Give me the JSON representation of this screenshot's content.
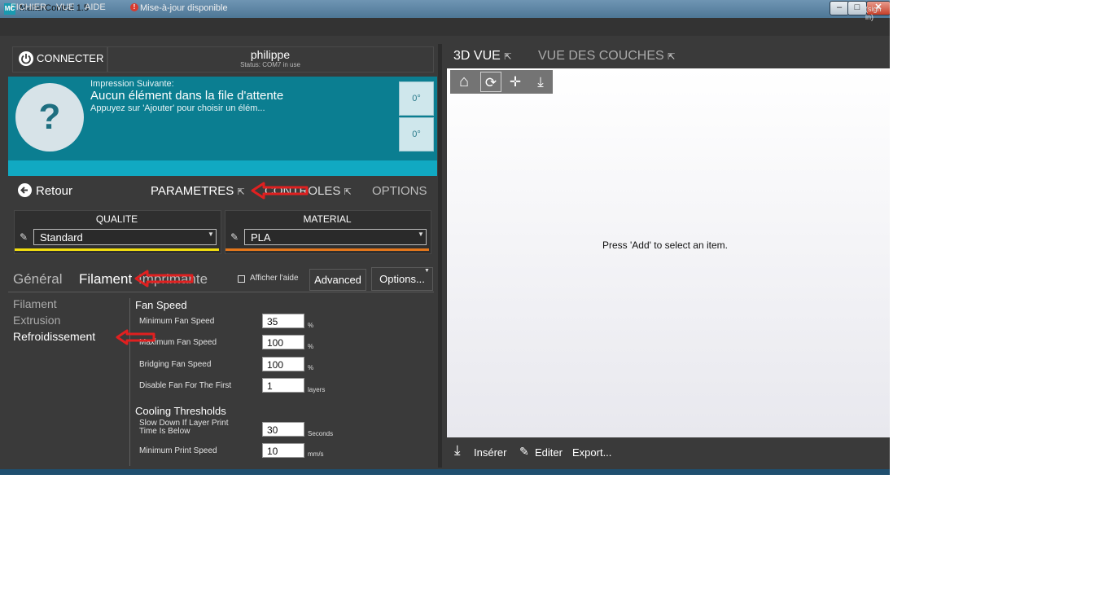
{
  "window": {
    "title": "MatterControl 1.5",
    "icon_text": "MC",
    "min_glyph": "–",
    "max_glyph": "□",
    "close_glyph": "✕"
  },
  "menu": {
    "items": [
      "FICHIER",
      "VUE",
      "AIDE"
    ],
    "update_glyph": "!",
    "update_text": "Mise-à-jour disponible",
    "signin": "(sign in)"
  },
  "printer": {
    "connect_label": "CONNECTER",
    "name": "philippe",
    "status": "Status: COM7 in use"
  },
  "queue": {
    "thumb_glyph": "?",
    "next_label": "Impression Suivante:",
    "empty": "Aucun élément dans la file d'attente",
    "hint": "Appuyez sur 'Ajouter' pour choisir un élém...",
    "temp1": "0°",
    "temp2": "0°"
  },
  "tabs": {
    "back": "Retour",
    "parametres": "PARAMETRES",
    "controles": "CONTROLES",
    "options": "OPTIONS"
  },
  "presets": {
    "quality_title": "QUALITE",
    "quality_value": "Standard",
    "material_title": "MATERIAL",
    "material_value": "PLA",
    "quality_color": "#f2de0f",
    "material_color": "#e5771b"
  },
  "settings_tabs": {
    "general": "Général",
    "filament": "Filament",
    "imprimante": "Imprimante",
    "help_label": "Afficher l'aide",
    "advanced": "Advanced",
    "options": "Options..."
  },
  "categories": {
    "filament": "Filament",
    "extrusion": "Extrusion",
    "cooling": "Refroidissement"
  },
  "fan_speed": {
    "title": "Fan Speed",
    "min_label": "Minimum Fan Speed",
    "min_value": "35",
    "min_unit": "%",
    "max_label": "Maximum Fan Speed",
    "max_value": "100",
    "max_unit": "%",
    "bridge_label": "Bridging Fan Speed",
    "bridge_value": "100",
    "bridge_unit": "%",
    "disable_label": "Disable Fan For The First",
    "disable_value": "1",
    "disable_unit": "layers"
  },
  "cooling_thresholds": {
    "title": "Cooling Thresholds",
    "slow_label_1": "Slow Down If Layer Print",
    "slow_label_2": "Time Is Below",
    "slow_value": "30",
    "slow_unit": "Seconds",
    "min_speed_label": "Minimum Print Speed",
    "min_speed_value": "10",
    "min_speed_unit": "mm/s"
  },
  "view": {
    "tab_3d": "3D VUE",
    "tab_layers": "VUE DES COUCHES",
    "empty_message": "Press 'Add' to select an item.",
    "insert": "Insérer",
    "edit": "Editer",
    "export": "Export..."
  },
  "icons": {
    "ext": "⇱",
    "caret": "▼",
    "pen": "✎",
    "home": "⌂",
    "rotate": "⟳",
    "move": "✛",
    "drop": "⤓",
    "insert": "⤓",
    "edit": "✎"
  },
  "colors": {
    "accent": "#0b7e91",
    "accent_light": "#11a9c2",
    "panel": "#3a3a3a",
    "annotation_arrow": "#e02020"
  }
}
